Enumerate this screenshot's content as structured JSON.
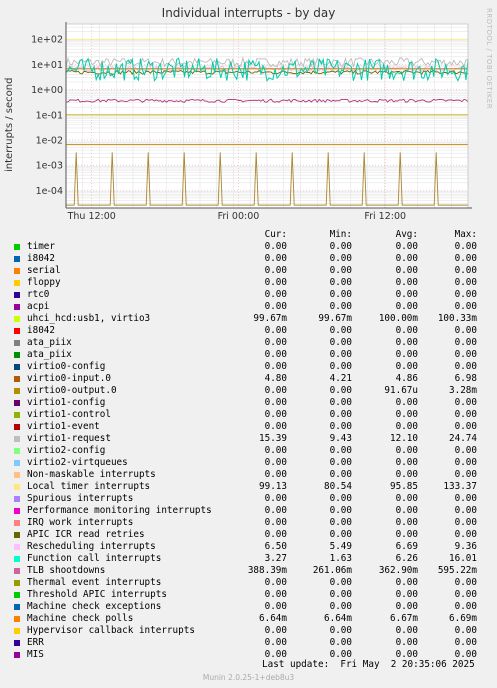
{
  "chart_data": {
    "type": "line",
    "title": "Individual interrupts - by day",
    "ylabel": "interrupts / second",
    "yscale": "log",
    "ylim": [
      2e-05,
      400
    ],
    "y_ticks": [
      {
        "v": 100,
        "label": "1e+02"
      },
      {
        "v": 10,
        "label": "1e+01"
      },
      {
        "v": 1,
        "label": "1e+00"
      },
      {
        "v": 0.1,
        "label": "1e-01"
      },
      {
        "v": 0.01,
        "label": "1e-02"
      },
      {
        "v": 0.001,
        "label": "1e-03"
      },
      {
        "v": 0.0001,
        "label": "1e-04"
      }
    ],
    "x_ticks": [
      {
        "pos": 0.064,
        "label": "Thu 12:00"
      },
      {
        "pos": 0.429,
        "label": "Fri 00:00"
      },
      {
        "pos": 0.794,
        "label": "Fri 12:00"
      }
    ],
    "x_minor_count": 24,
    "grid": true,
    "series_lines": [
      {
        "name": "Local timer interrupts",
        "color": "#ffe77a",
        "level": 99.13
      },
      {
        "name": "virtio1-request",
        "color": "#bbbbbb",
        "level": 12.1,
        "noise": 0.35
      },
      {
        "name": "Rescheduling interrupts",
        "color": "#f7b7d2",
        "level": 6.69,
        "noise": 0.2
      },
      {
        "name": "Machine check polls",
        "color": "#cc7700",
        "level": 6.67
      },
      {
        "name": "virtio0-input.0",
        "color": "#666600",
        "level": 4.86,
        "noise": 0.15
      },
      {
        "name": "Function call interrupts",
        "color": "#00ccaa",
        "level": 6.26,
        "noise": 0.9
      },
      {
        "name": "TLB shootdowns",
        "color": "#aa3377",
        "level": 0.3629,
        "noise": 0.12
      },
      {
        "name": "uhci_hcd:usb1, virtio3",
        "color": "#ccaa00",
        "level": 0.1
      },
      {
        "name": "Hypervisor callback interrupts",
        "color": "#cc8800",
        "level": 0.0067
      },
      {
        "name": "virtio0-output.0",
        "color": "#aa8833",
        "level": 9.167e-05,
        "spikes": 11
      }
    ],
    "legend_header": {
      "cur": "Cur:",
      "min": "Min:",
      "avg": "Avg:",
      "max": "Max:"
    },
    "legend": [
      {
        "name": "timer",
        "color": "#00cc00",
        "cur": "0.00",
        "min": "0.00",
        "avg": "0.00",
        "max": "0.00"
      },
      {
        "name": "i8042",
        "color": "#0066b3",
        "cur": "0.00",
        "min": "0.00",
        "avg": "0.00",
        "max": "0.00"
      },
      {
        "name": "serial",
        "color": "#ff8000",
        "cur": "0.00",
        "min": "0.00",
        "avg": "0.00",
        "max": "0.00"
      },
      {
        "name": "floppy",
        "color": "#ffcc00",
        "cur": "0.00",
        "min": "0.00",
        "avg": "0.00",
        "max": "0.00"
      },
      {
        "name": "rtc0",
        "color": "#330099",
        "cur": "0.00",
        "min": "0.00",
        "avg": "0.00",
        "max": "0.00"
      },
      {
        "name": "acpi",
        "color": "#990099",
        "cur": "0.00",
        "min": "0.00",
        "avg": "0.00",
        "max": "0.00"
      },
      {
        "name": "uhci_hcd:usb1, virtio3",
        "color": "#ccff00",
        "cur": "99.67m",
        "min": "99.67m",
        "avg": "100.00m",
        "max": "100.33m"
      },
      {
        "name": "i8042",
        "color": "#ff0000",
        "cur": "0.00",
        "min": "0.00",
        "avg": "0.00",
        "max": "0.00"
      },
      {
        "name": "ata_piix",
        "color": "#808080",
        "cur": "0.00",
        "min": "0.00",
        "avg": "0.00",
        "max": "0.00"
      },
      {
        "name": "ata_piix",
        "color": "#008f00",
        "cur": "0.00",
        "min": "0.00",
        "avg": "0.00",
        "max": "0.00"
      },
      {
        "name": "virtio0-config",
        "color": "#00487d",
        "cur": "0.00",
        "min": "0.00",
        "avg": "0.00",
        "max": "0.00"
      },
      {
        "name": "virtio0-input.0",
        "color": "#b35a00",
        "cur": "4.80",
        "min": "4.21",
        "avg": "4.86",
        "max": "6.98"
      },
      {
        "name": "virtio0-output.0",
        "color": "#b38f00",
        "cur": "0.00",
        "min": "0.00",
        "avg": "91.67u",
        "max": "3.28m"
      },
      {
        "name": "virtio1-config",
        "color": "#6b006b",
        "cur": "0.00",
        "min": "0.00",
        "avg": "0.00",
        "max": "0.00"
      },
      {
        "name": "virtio1-control",
        "color": "#8fb300",
        "cur": "0.00",
        "min": "0.00",
        "avg": "0.00",
        "max": "0.00"
      },
      {
        "name": "virtio1-event",
        "color": "#b30000",
        "cur": "0.00",
        "min": "0.00",
        "avg": "0.00",
        "max": "0.00"
      },
      {
        "name": "virtio1-request",
        "color": "#bebebe",
        "cur": "15.39",
        "min": "9.43",
        "avg": "12.10",
        "max": "24.74"
      },
      {
        "name": "virtio2-config",
        "color": "#80ff80",
        "cur": "0.00",
        "min": "0.00",
        "avg": "0.00",
        "max": "0.00"
      },
      {
        "name": "virtio2-virtqueues",
        "color": "#80c9ff",
        "cur": "0.00",
        "min": "0.00",
        "avg": "0.00",
        "max": "0.00"
      },
      {
        "name": "Non-maskable interrupts",
        "color": "#ffc080",
        "cur": "0.00",
        "min": "0.00",
        "avg": "0.00",
        "max": "0.00"
      },
      {
        "name": "Local timer interrupts",
        "color": "#ffe680",
        "cur": "99.13",
        "min": "80.54",
        "avg": "95.85",
        "max": "133.37"
      },
      {
        "name": "Spurious interrupts",
        "color": "#aa80ff",
        "cur": "0.00",
        "min": "0.00",
        "avg": "0.00",
        "max": "0.00"
      },
      {
        "name": "Performance monitoring interrupts",
        "color": "#ee00cc",
        "cur": "0.00",
        "min": "0.00",
        "avg": "0.00",
        "max": "0.00"
      },
      {
        "name": "IRQ work interrupts",
        "color": "#ff8080",
        "cur": "0.00",
        "min": "0.00",
        "avg": "0.00",
        "max": "0.00"
      },
      {
        "name": "APIC ICR read retries",
        "color": "#666600",
        "cur": "0.00",
        "min": "0.00",
        "avg": "0.00",
        "max": "0.00"
      },
      {
        "name": "Rescheduling interrupts",
        "color": "#ffbfff",
        "cur": "6.50",
        "min": "5.49",
        "avg": "6.69",
        "max": "9.36"
      },
      {
        "name": "Function call interrupts",
        "color": "#00ffcc",
        "cur": "3.27",
        "min": "1.63",
        "avg": "6.26",
        "max": "16.01"
      },
      {
        "name": "TLB shootdowns",
        "color": "#cc6699",
        "cur": "388.39m",
        "min": "261.06m",
        "avg": "362.90m",
        "max": "595.22m"
      },
      {
        "name": "Thermal event interrupts",
        "color": "#999900",
        "cur": "0.00",
        "min": "0.00",
        "avg": "0.00",
        "max": "0.00"
      },
      {
        "name": "Threshold APIC interrupts",
        "color": "#00cc00",
        "cur": "0.00",
        "min": "0.00",
        "avg": "0.00",
        "max": "0.00"
      },
      {
        "name": "Machine check exceptions",
        "color": "#0066b3",
        "cur": "0.00",
        "min": "0.00",
        "avg": "0.00",
        "max": "0.00"
      },
      {
        "name": "Machine check polls",
        "color": "#ff8000",
        "cur": "6.64m",
        "min": "6.64m",
        "avg": "6.67m",
        "max": "6.69m"
      },
      {
        "name": "Hypervisor callback interrupts",
        "color": "#ffcc00",
        "cur": "0.00",
        "min": "0.00",
        "avg": "0.00",
        "max": "0.00"
      },
      {
        "name": "ERR",
        "color": "#330099",
        "cur": "0.00",
        "min": "0.00",
        "avg": "0.00",
        "max": "0.00"
      },
      {
        "name": "MIS",
        "color": "#990099",
        "cur": "0.00",
        "min": "0.00",
        "avg": "0.00",
        "max": "0.00"
      }
    ]
  },
  "last_update": "Last update:  Fri May  2 20:35:06 2025",
  "side_label": "RRDTOOL / TOBI OETIKER",
  "footer": "Munin 2.0.25-1+deb8u3"
}
